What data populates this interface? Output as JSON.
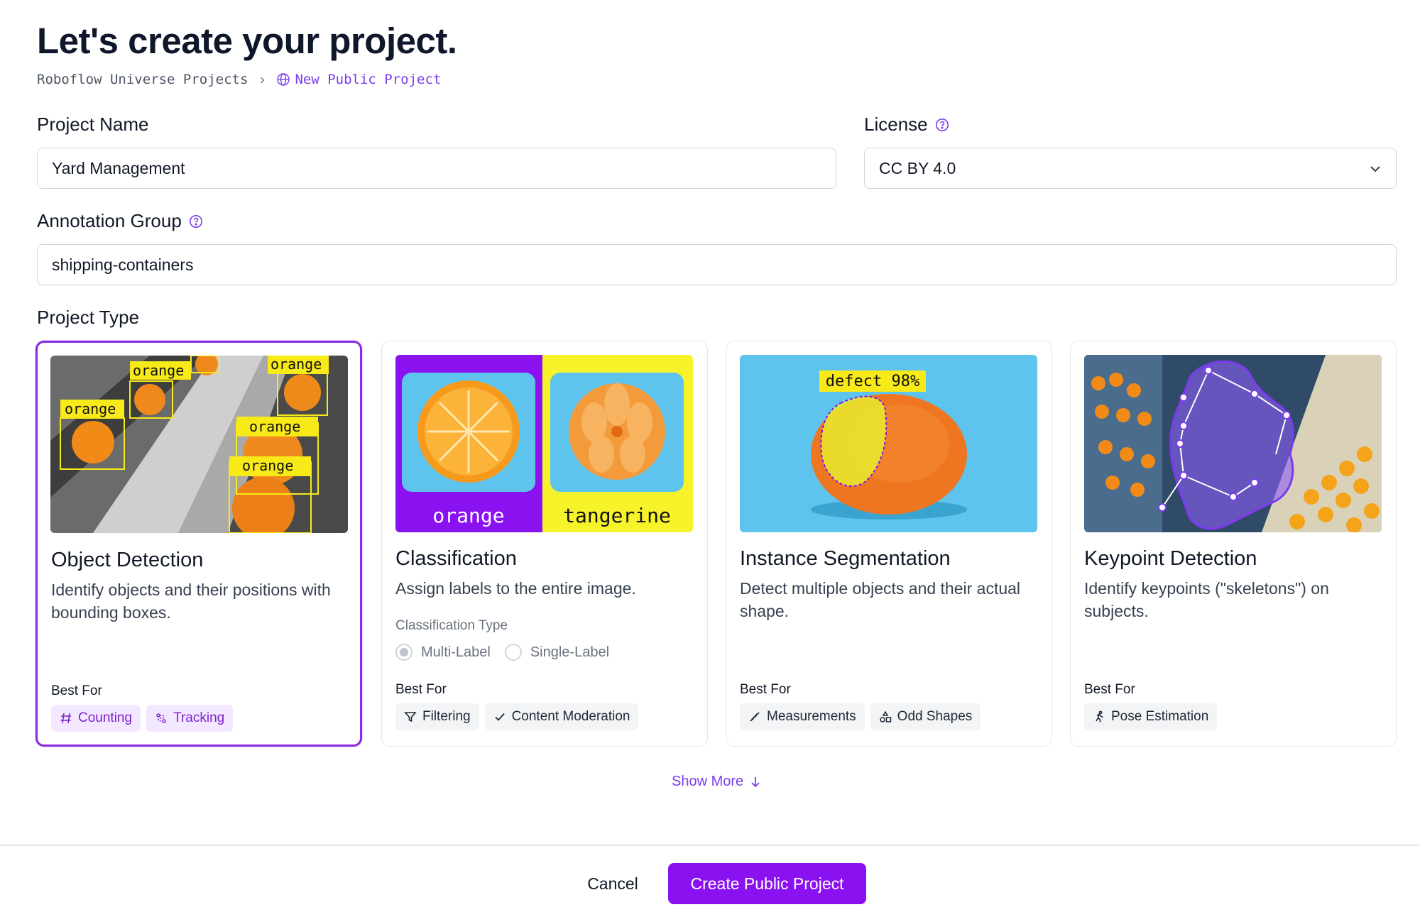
{
  "page": {
    "title": "Let's create your project.",
    "breadcrumb": {
      "root": "Roboflow Universe Projects",
      "current": "New Public Project"
    }
  },
  "form": {
    "project_name": {
      "label": "Project Name",
      "value": "Yard Management"
    },
    "license": {
      "label": "License",
      "value": "CC BY 4.0"
    },
    "annotation_group": {
      "label": "Annotation Group",
      "value": "shipping-containers"
    },
    "project_type_label": "Project Type"
  },
  "cards": [
    {
      "title": "Object Detection",
      "description": "Identify objects and their positions with bounding boxes.",
      "best_for_label": "Best For",
      "tags": [
        "Counting",
        "Tracking"
      ],
      "image_labels": [
        "orange",
        "orange",
        "orange",
        "orange",
        "orange"
      ],
      "selected": true
    },
    {
      "title": "Classification",
      "description": "Assign labels to the entire image.",
      "classification_type_label": "Classification Type",
      "options": [
        "Multi-Label",
        "Single-Label"
      ],
      "selected_option": "Multi-Label",
      "best_for_label": "Best For",
      "tags": [
        "Filtering",
        "Content Moderation"
      ],
      "image_labels": [
        "orange",
        "tangerine"
      ]
    },
    {
      "title": "Instance Segmentation",
      "description": "Detect multiple objects and their actual shape.",
      "best_for_label": "Best For",
      "tags": [
        "Measurements",
        "Odd Shapes"
      ],
      "image_labels": [
        "defect 98%"
      ]
    },
    {
      "title": "Keypoint Detection",
      "description": "Identify keypoints (\"skeletons\") on subjects.",
      "best_for_label": "Best For",
      "tags": [
        "Pose Estimation"
      ]
    }
  ],
  "show_more": "Show More",
  "footer": {
    "cancel": "Cancel",
    "create": "Create Public Project"
  },
  "colors": {
    "accent": "#8b12f0",
    "tag_purple_bg": "#f3e8ff",
    "tag_purple_text": "#7e22ce"
  },
  "icons": [
    "chevron-right-icon",
    "globe-icon",
    "help-circle-icon",
    "chevron-down-icon",
    "hash-icon",
    "tracking-icon",
    "filter-icon",
    "check-icon",
    "ruler-icon",
    "shapes-icon",
    "running-person-icon",
    "arrow-down-icon"
  ]
}
